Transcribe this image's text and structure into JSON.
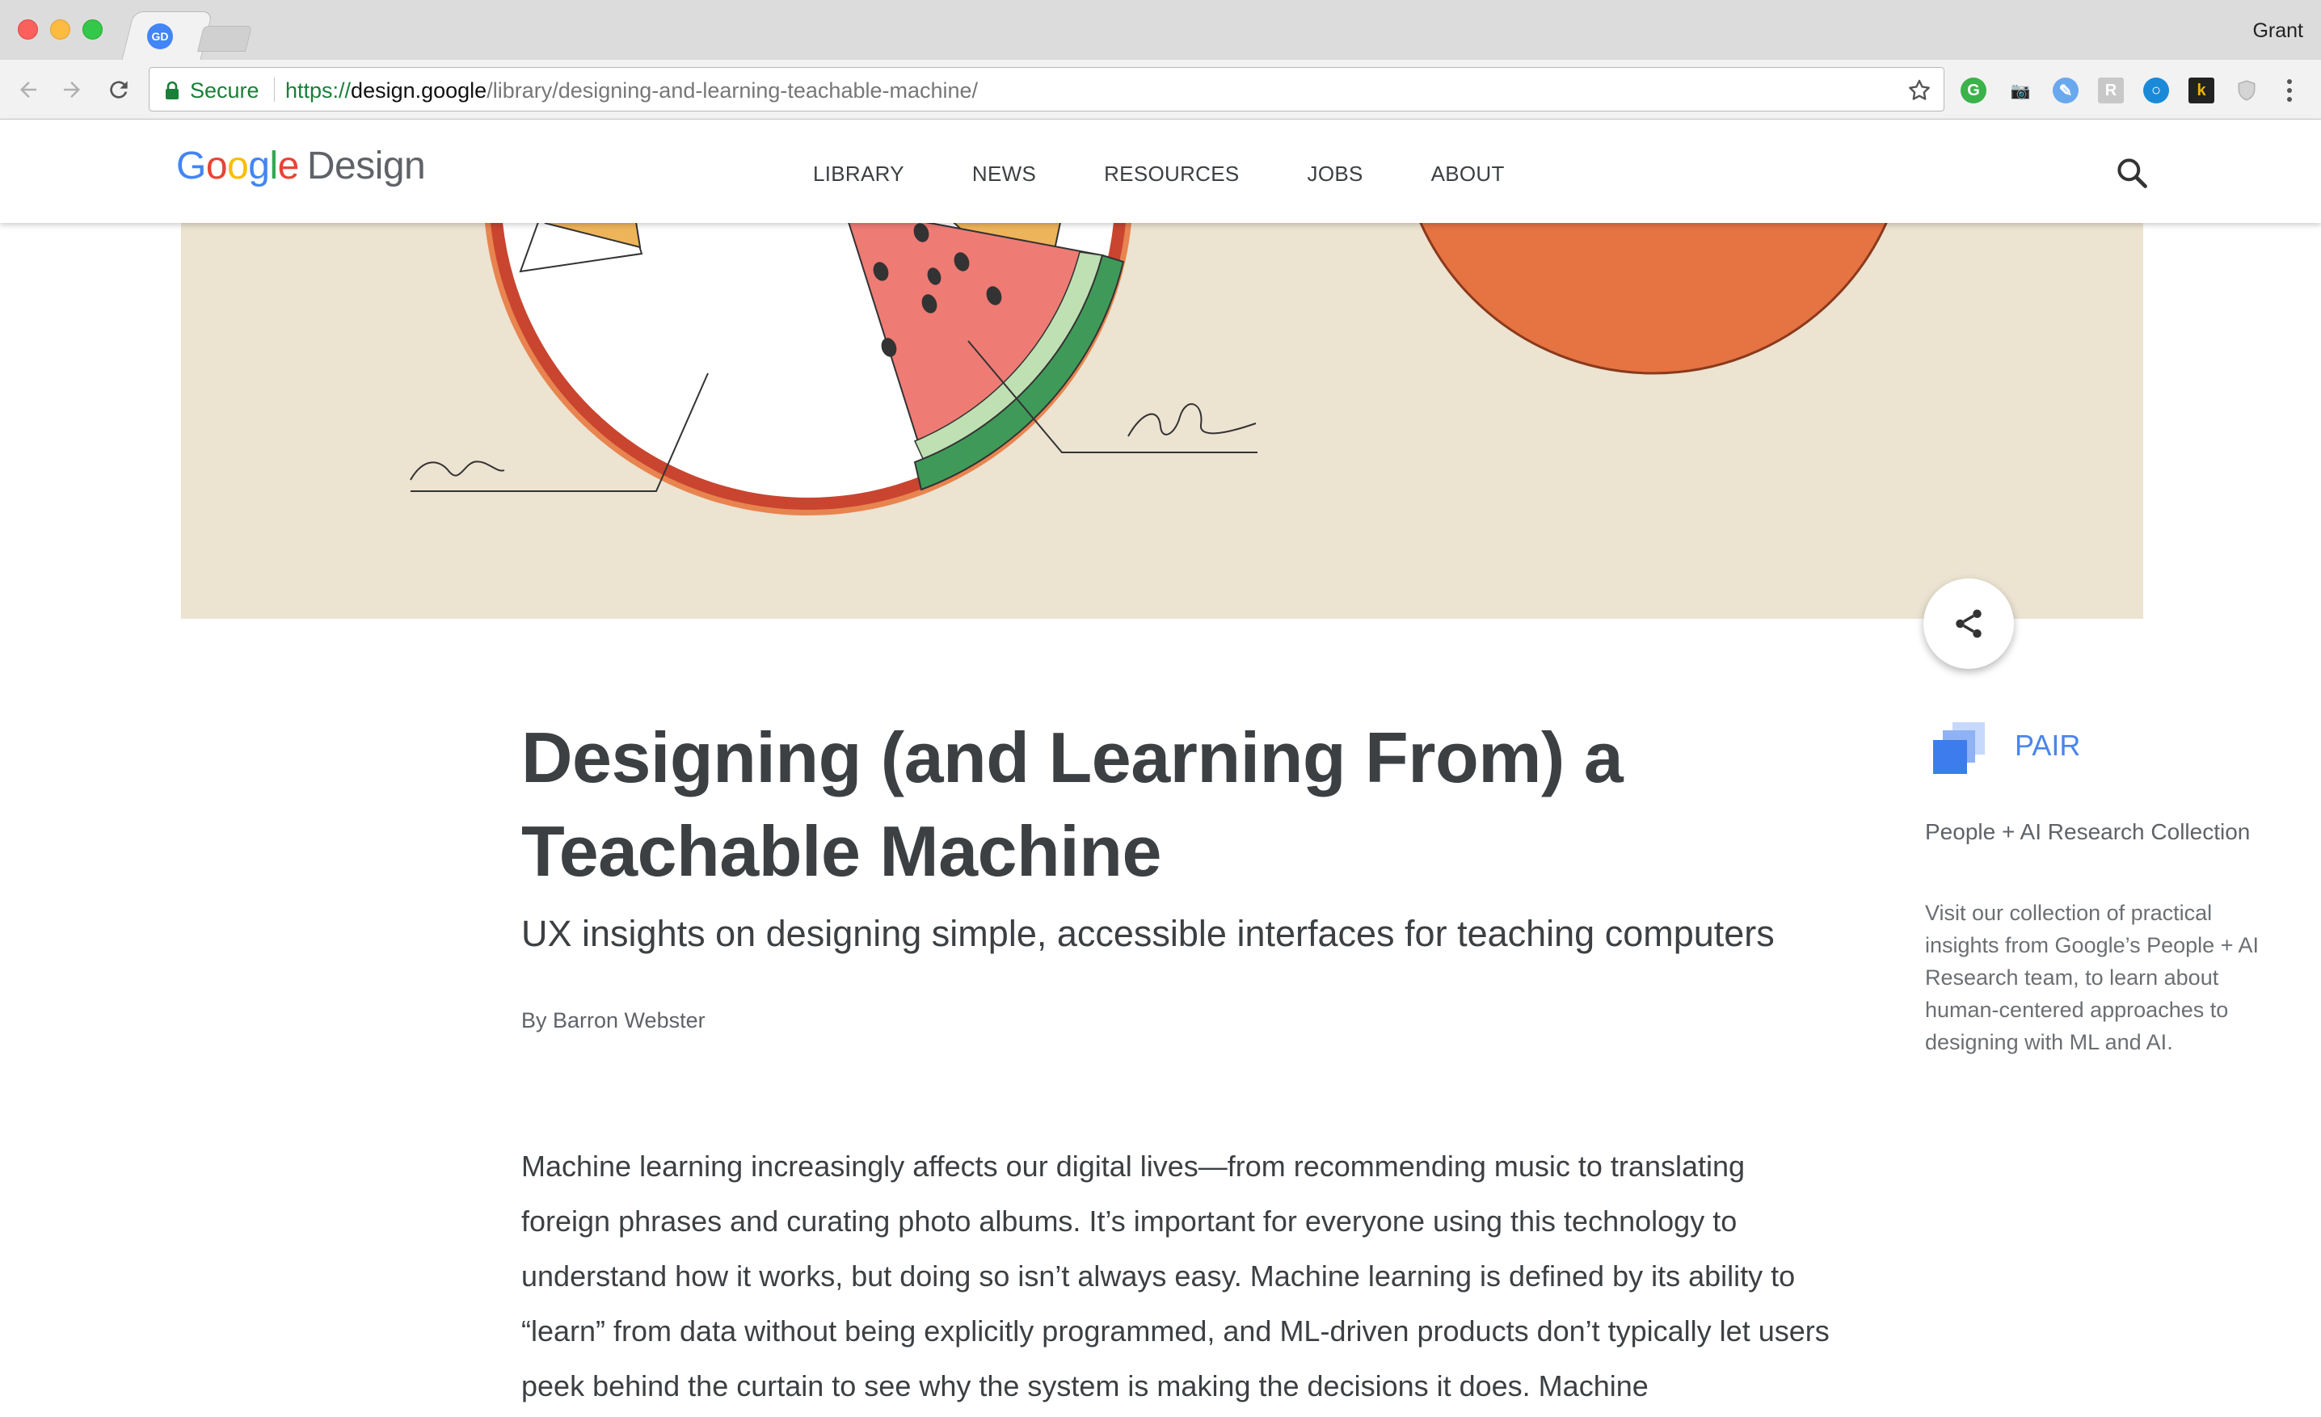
{
  "browser": {
    "profile_name": "Grant",
    "tab_favicon_text": "GD",
    "secure_label": "Secure",
    "url": {
      "scheme": "https://",
      "host": "design.google",
      "path": "/library/designing-and-learning-teachable-machine/"
    },
    "extensions": [
      {
        "name": "grammarly-icon",
        "glyph": "G"
      },
      {
        "name": "camera-extension-icon",
        "glyph": "📷"
      },
      {
        "name": "feather-extension-icon",
        "glyph": "✎"
      },
      {
        "name": "r-extension-icon",
        "glyph": "R"
      },
      {
        "name": "circle-extension-icon",
        "glyph": "○"
      },
      {
        "name": "k-extension-icon",
        "glyph": "k"
      },
      {
        "name": "shield-extension-icon",
        "glyph": "⛨"
      }
    ]
  },
  "site": {
    "logo_letters": [
      "G",
      "o",
      "o",
      "g",
      "l",
      "e"
    ],
    "logo_design": "Design",
    "nav": [
      "LIBRARY",
      "NEWS",
      "RESOURCES",
      "JOBS",
      "ABOUT"
    ]
  },
  "article": {
    "title": "Designing (and Learning From) a Teachable Machine",
    "subtitle": "UX insights on designing simple, accessible interfaces for teaching computers",
    "byline": "By Barron Webster",
    "body": "Machine learning increasingly affects our digital lives—from recommending music to translating foreign phrases and curating photo albums. It’s important for everyone using this technology to understand how it works, but doing so isn’t always easy. Machine learning is defined by its ability to “learn” from data without being explicitly programmed, and ML-driven products don’t typically let users peek behind the curtain to see why the system is making the decisions it does. Machine"
  },
  "sidebar": {
    "title": "PAIR",
    "collection": "People + AI Research Collection",
    "description": "Visit our collection of practical insights from Google’s People + AI Research team, to learn about human-centered approaches to designing with ML and AI."
  },
  "colors": {
    "accent_blue": "#4a86e8",
    "hero_background": "#ece3d1",
    "watermelon_red": "#ef7b75",
    "rind_green": "#3f9a59",
    "orange_circle": "#e67342",
    "plate_rim": "#c9452f"
  }
}
